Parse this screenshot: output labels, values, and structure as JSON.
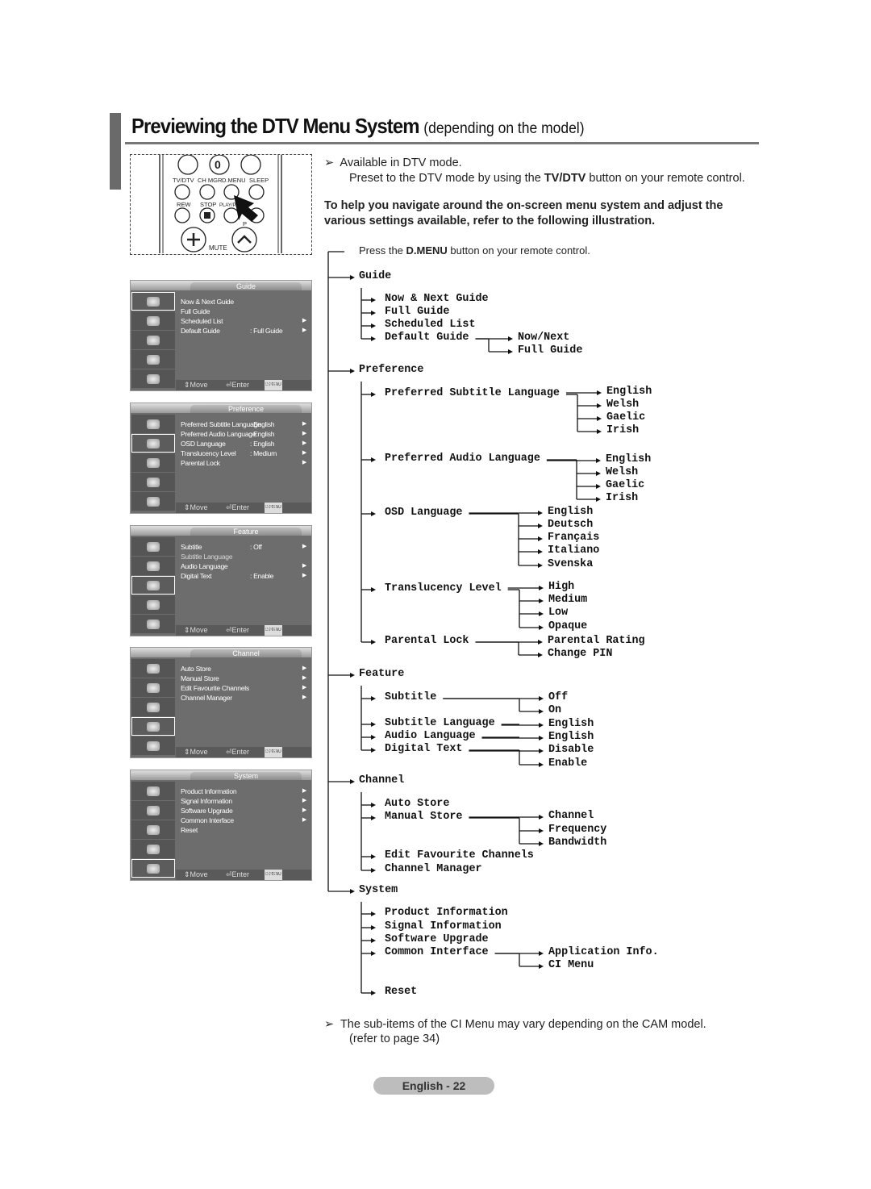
{
  "header": {
    "title": "Previewing the DTV Menu System",
    "subtitle": "(depending on the model)"
  },
  "notes": {
    "available": "Available in DTV mode.",
    "preset_pre": "Preset to the DTV mode by using the ",
    "preset_bold": "TV/DTV",
    "preset_post": " button on your remote control.",
    "intro_line1": "To help you navigate around the on-screen menu system and adjust the",
    "intro_line2": "various settings available, refer to the following illustration.",
    "press_pre": "Press the ",
    "press_bold": "D.MENU",
    "press_post": " button on your remote control.",
    "ci_line1": "The sub-items of the CI Menu may vary depending on the CAM model.",
    "ci_line2": "(refer to page 34)"
  },
  "remote": {
    "buttons": [
      "TV/DTV",
      "CH MGR",
      "D.MENU",
      "SLEEP",
      "REW",
      "STOP",
      "PLAY/PAUSE",
      "MUTE",
      "P",
      "0"
    ]
  },
  "panels": [
    {
      "title": "Guide",
      "selected": 0,
      "items": [
        {
          "label": "Now & Next Guide"
        },
        {
          "label": "Full Guide"
        },
        {
          "label": "Scheduled List",
          "arrow": true
        },
        {
          "label": "Default Guide",
          "value": ": Full Guide",
          "arrow": true
        }
      ]
    },
    {
      "title": "Preference",
      "selected": 1,
      "items": [
        {
          "label": "Preferred Subtitle Language",
          "value": ": English",
          "arrow": true
        },
        {
          "label": "Preferred Audio Language",
          "value": ": English",
          "arrow": true
        },
        {
          "label": "OSD Language",
          "value": ": English",
          "arrow": true
        },
        {
          "label": "Translucency Level",
          "value": ": Medium",
          "arrow": true
        },
        {
          "label": "Parental Lock",
          "arrow": true
        }
      ]
    },
    {
      "title": "Feature",
      "selected": 2,
      "items": [
        {
          "label": "Subtitle",
          "value": ": Off",
          "arrow": true
        },
        {
          "label": "Subtitle Language",
          "dim": true
        },
        {
          "label": "Audio Language",
          "arrow": true
        },
        {
          "label": "Digital Text",
          "value": ": Enable",
          "arrow": true
        }
      ]
    },
    {
      "title": "Channel",
      "selected": 3,
      "items": [
        {
          "label": "Auto Store",
          "arrow": true
        },
        {
          "label": "Manual Store",
          "arrow": true
        },
        {
          "label": "Edit Favourite Channels",
          "arrow": true
        },
        {
          "label": "Channel Manager",
          "arrow": true
        }
      ]
    },
    {
      "title": "System",
      "selected": 4,
      "items": [
        {
          "label": "Product Information",
          "arrow": true
        },
        {
          "label": "Signal Information",
          "arrow": true
        },
        {
          "label": "Software Upgrade",
          "arrow": true
        },
        {
          "label": "Common Interface",
          "arrow": true
        },
        {
          "label": "Reset"
        }
      ]
    }
  ],
  "panel_footer": {
    "move": "Move",
    "enter": "Enter",
    "dmenu": "D.MENU",
    "exit": "Exit"
  },
  "tree": [
    {
      "label": "Guide",
      "items": [
        {
          "label": "Now & Next Guide"
        },
        {
          "label": "Full Guide"
        },
        {
          "label": "Scheduled List"
        },
        {
          "label": "Default Guide",
          "options": [
            "Now/Next",
            "Full Guide"
          ]
        }
      ]
    },
    {
      "label": "Preference",
      "items": [
        {
          "label": "Preferred Subtitle Language",
          "options": [
            "English",
            "Welsh",
            "Gaelic",
            "Irish"
          ]
        },
        {
          "label": "Preferred Audio Language",
          "options": [
            "English",
            "Welsh",
            "Gaelic",
            "Irish"
          ]
        },
        {
          "label": "OSD Language",
          "options": [
            "English",
            "Deutsch",
            "Français",
            "Italiano",
            "Svenska"
          ]
        },
        {
          "label": "Translucency Level",
          "options": [
            "High",
            "Medium",
            "Low",
            "Opaque"
          ]
        },
        {
          "label": "Parental Lock",
          "options": [
            "Parental Rating",
            "Change PIN"
          ]
        }
      ]
    },
    {
      "label": "Feature",
      "items": [
        {
          "label": "Subtitle",
          "options": [
            "Off",
            "On"
          ]
        },
        {
          "label": "Subtitle Language",
          "options": [
            "English"
          ]
        },
        {
          "label": "Audio Language",
          "options": [
            "English"
          ]
        },
        {
          "label": "Digital Text",
          "options": [
            "Disable",
            "Enable"
          ]
        }
      ]
    },
    {
      "label": "Channel",
      "items": [
        {
          "label": "Auto Store"
        },
        {
          "label": "Manual Store",
          "options": [
            "Channel",
            "Frequency",
            "Bandwidth"
          ]
        },
        {
          "label": "Edit Favourite Channels"
        },
        {
          "label": "Channel Manager"
        }
      ]
    },
    {
      "label": "System",
      "items": [
        {
          "label": "Product Information"
        },
        {
          "label": "Signal Information"
        },
        {
          "label": "Software Upgrade"
        },
        {
          "label": "Common Interface",
          "options": [
            "Application Info.",
            "CI Menu"
          ]
        },
        {
          "label": "Reset"
        }
      ]
    }
  ],
  "footer": {
    "page_label": "English - 22"
  }
}
